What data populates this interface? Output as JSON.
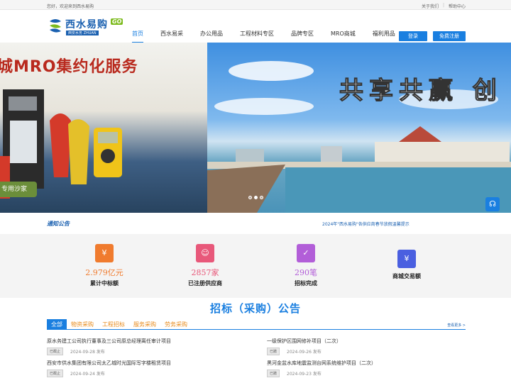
{
  "topbar": {
    "welcome": "您好，欢迎来到西水易购",
    "links": [
      "关于我们",
      "帮助中心"
    ]
  },
  "logo": {
    "title": "西水易购",
    "go": "GO",
    "subtitle": "西安水务 ZHUAN"
  },
  "nav": {
    "items": [
      "首页",
      "西水易采",
      "办公用品",
      "工程材料专区",
      "品牌专区",
      "MRO商城",
      "福利用品"
    ]
  },
  "buttons": {
    "login": "登录",
    "register": "免费注册"
  },
  "banner": {
    "left_text": "城MRO集约化服务",
    "right_text": "共享共赢 创",
    "tag": "专用沙家"
  },
  "notice": {
    "label": "通知公告",
    "text": "2024年\"西水易购\"各供应商春节放假温馨提示"
  },
  "stats": [
    {
      "value": "2.979亿元",
      "label": "累计中标额",
      "color": "#f07b2e",
      "icon": "yen-icon"
    },
    {
      "value": "2857家",
      "label": "已注册供应商",
      "color": "#e8587a",
      "icon": "user-icon"
    },
    {
      "value": "290笔",
      "label": "招标完成",
      "color": "#b25ed8",
      "icon": "check-icon"
    },
    {
      "value": "",
      "label": "商城交易额",
      "color": "#4a5fe0",
      "icon": "yen-icon"
    }
  ],
  "section": {
    "title": "招标（采购）公告"
  },
  "tabs": [
    "全部",
    "物资采购",
    "工程招标",
    "服务采购",
    "劳务采购"
  ],
  "more": "查看更多 >",
  "list_left": [
    {
      "title": "原水务建工公司执行董事及三公司原总经理离任审计项目",
      "status": "已截止",
      "date": "2024-09-28 发布"
    },
    {
      "title": "西安市供水集团有限公司太乙城时光国际写字楼租赁项目",
      "status": "已截止",
      "date": "2024-09-24 发布"
    }
  ],
  "list_right": [
    {
      "title": "一级保护区围网修补项目（二次）",
      "status": "已撤",
      "date": "2024-09-26 发布"
    },
    {
      "title": "黑河金盆水库地震监测台网系统维护项目（二次）",
      "status": "已撤",
      "date": "2024-09-23 发布"
    }
  ]
}
